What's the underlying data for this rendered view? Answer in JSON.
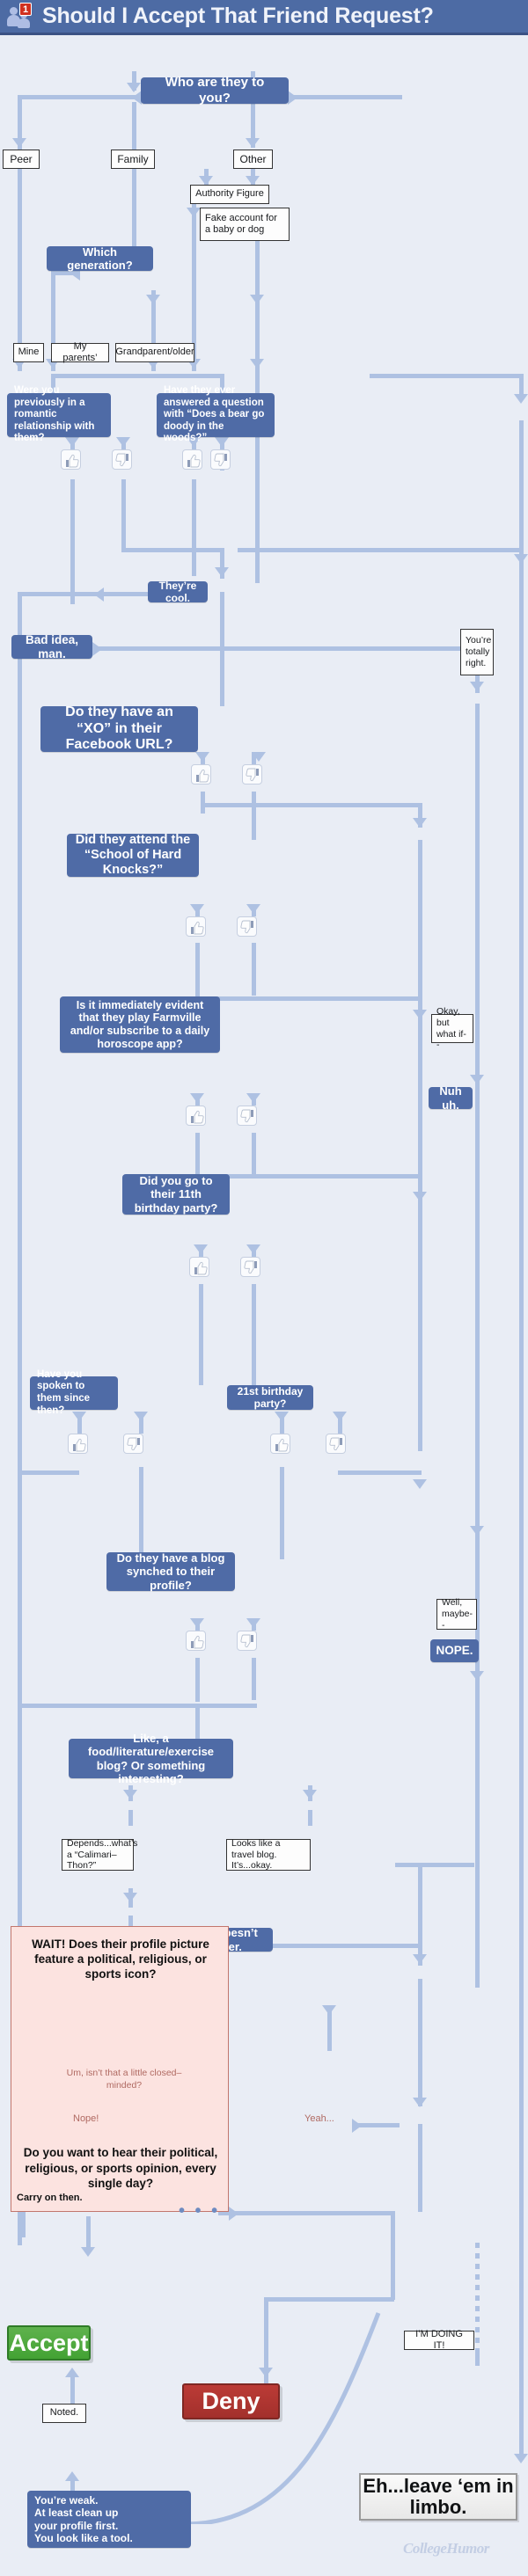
{
  "header": {
    "title": "Should I Accept That Friend Request?",
    "badge_count": "1",
    "icon": "friends-icon",
    "bg_color": "#4d6ba4"
  },
  "colors": {
    "canvas": "#e9edf5",
    "node_blue": "#4f6ba6",
    "connector": "#aec1e2",
    "accept_green": "#43a233",
    "deny_red": "#a3302c",
    "wait_panel_pink": "#fce3e0",
    "wait_panel_border": "#c2766d"
  },
  "flow": {
    "root": "Who are they to you?",
    "branch_peer": "Peer",
    "branch_family": "Family",
    "branch_other": "Other",
    "authority_figure": "Authority Figure",
    "fake_account": "Fake account for a baby or dog",
    "which_generation": "Which generation?",
    "gen_mine": "Mine",
    "gen_parents": "My parents’",
    "gen_grandparent": "Grandparent/older",
    "romantic": "Were you previously in a romantic relationship with them?",
    "bear_doody": "Have they ever answered a question with “Does a bear go doody in the woods?”",
    "theyre_cool": "They’re cool.",
    "bad_idea": "Bad idea, man.",
    "youre_totally_right": "You’re totally right.",
    "xo_url": "Do they have an “XO” in their Facebook URL?",
    "hard_knocks": "Did they attend the “School of Hard Knocks?”",
    "farmville": "Is it immediately evident that they play Farmville and/or subscribe to a daily horoscope app?",
    "okay_but_what_if": "Okay, but what if--",
    "nuh_uh": "Nuh uh.",
    "eleventh_birthday": "Did you go to their 11th birthday party?",
    "spoken_since": "Have you spoken to them since then?",
    "twentyfirst_birthday": "21st birthday party?",
    "blog_synched": "Do they have a blog synched to their profile?",
    "well_maybe": "Well, maybe--",
    "nope": "NOPE.",
    "food_blog": "Like, a food/literature/exercise blog? Or something interesting?",
    "calimari": "Depends...what’s a “Calimari–Thon?”",
    "travel_blog": "Looks like a travel blog. It’s...okay.",
    "ugh_doesnt_matter": "Ugh, doesn’t matter."
  },
  "wait_panel": {
    "question": "WAIT! Does their profile picture feature a political, religious, or sports icon?",
    "closed_minded": "Um, isn’t that a little closed–minded?",
    "nope_label": "Nope!",
    "yeah_label": "Yeah...",
    "opinion_question": "Do you want to hear their political, religious, or sports opinion, every single day?",
    "carry_on": "Carry on then.",
    "ellipsis": "• • •"
  },
  "results": {
    "accept": "Accept",
    "deny": "Deny",
    "limbo": "Eh...leave ‘em in limbo.",
    "noted": "Noted.",
    "im_doing_it": "I’M DOING IT!",
    "youre_weak": "You’re weak.\nAt least clean up\nyour profile first.\nYou look like a tool."
  },
  "footer": {
    "logo": "CollegeHumor"
  }
}
